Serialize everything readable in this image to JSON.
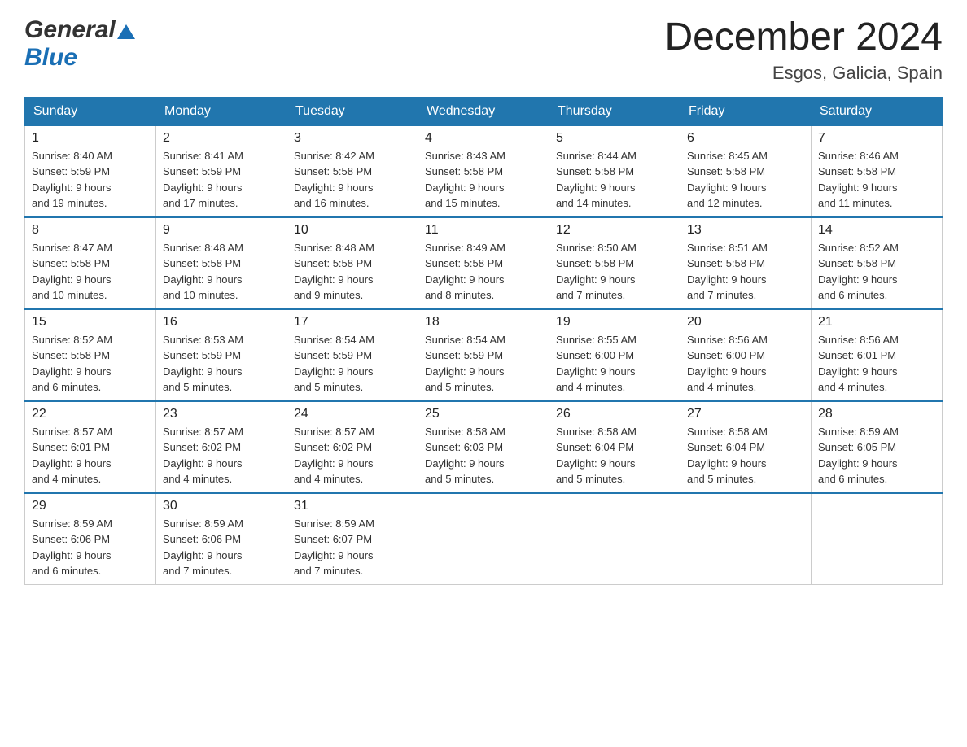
{
  "header": {
    "logo_general": "General",
    "logo_blue": "Blue",
    "month_title": "December 2024",
    "location": "Esgos, Galicia, Spain"
  },
  "weekdays": [
    "Sunday",
    "Monday",
    "Tuesday",
    "Wednesday",
    "Thursday",
    "Friday",
    "Saturday"
  ],
  "weeks": [
    [
      {
        "day": "1",
        "sunrise": "8:40 AM",
        "sunset": "5:59 PM",
        "daylight": "9 hours and 19 minutes."
      },
      {
        "day": "2",
        "sunrise": "8:41 AM",
        "sunset": "5:59 PM",
        "daylight": "9 hours and 17 minutes."
      },
      {
        "day": "3",
        "sunrise": "8:42 AM",
        "sunset": "5:58 PM",
        "daylight": "9 hours and 16 minutes."
      },
      {
        "day": "4",
        "sunrise": "8:43 AM",
        "sunset": "5:58 PM",
        "daylight": "9 hours and 15 minutes."
      },
      {
        "day": "5",
        "sunrise": "8:44 AM",
        "sunset": "5:58 PM",
        "daylight": "9 hours and 14 minutes."
      },
      {
        "day": "6",
        "sunrise": "8:45 AM",
        "sunset": "5:58 PM",
        "daylight": "9 hours and 12 minutes."
      },
      {
        "day": "7",
        "sunrise": "8:46 AM",
        "sunset": "5:58 PM",
        "daylight": "9 hours and 11 minutes."
      }
    ],
    [
      {
        "day": "8",
        "sunrise": "8:47 AM",
        "sunset": "5:58 PM",
        "daylight": "9 hours and 10 minutes."
      },
      {
        "day": "9",
        "sunrise": "8:48 AM",
        "sunset": "5:58 PM",
        "daylight": "9 hours and 10 minutes."
      },
      {
        "day": "10",
        "sunrise": "8:48 AM",
        "sunset": "5:58 PM",
        "daylight": "9 hours and 9 minutes."
      },
      {
        "day": "11",
        "sunrise": "8:49 AM",
        "sunset": "5:58 PM",
        "daylight": "9 hours and 8 minutes."
      },
      {
        "day": "12",
        "sunrise": "8:50 AM",
        "sunset": "5:58 PM",
        "daylight": "9 hours and 7 minutes."
      },
      {
        "day": "13",
        "sunrise": "8:51 AM",
        "sunset": "5:58 PM",
        "daylight": "9 hours and 7 minutes."
      },
      {
        "day": "14",
        "sunrise": "8:52 AM",
        "sunset": "5:58 PM",
        "daylight": "9 hours and 6 minutes."
      }
    ],
    [
      {
        "day": "15",
        "sunrise": "8:52 AM",
        "sunset": "5:58 PM",
        "daylight": "9 hours and 6 minutes."
      },
      {
        "day": "16",
        "sunrise": "8:53 AM",
        "sunset": "5:59 PM",
        "daylight": "9 hours and 5 minutes."
      },
      {
        "day": "17",
        "sunrise": "8:54 AM",
        "sunset": "5:59 PM",
        "daylight": "9 hours and 5 minutes."
      },
      {
        "day": "18",
        "sunrise": "8:54 AM",
        "sunset": "5:59 PM",
        "daylight": "9 hours and 5 minutes."
      },
      {
        "day": "19",
        "sunrise": "8:55 AM",
        "sunset": "6:00 PM",
        "daylight": "9 hours and 4 minutes."
      },
      {
        "day": "20",
        "sunrise": "8:56 AM",
        "sunset": "6:00 PM",
        "daylight": "9 hours and 4 minutes."
      },
      {
        "day": "21",
        "sunrise": "8:56 AM",
        "sunset": "6:01 PM",
        "daylight": "9 hours and 4 minutes."
      }
    ],
    [
      {
        "day": "22",
        "sunrise": "8:57 AM",
        "sunset": "6:01 PM",
        "daylight": "9 hours and 4 minutes."
      },
      {
        "day": "23",
        "sunrise": "8:57 AM",
        "sunset": "6:02 PM",
        "daylight": "9 hours and 4 minutes."
      },
      {
        "day": "24",
        "sunrise": "8:57 AM",
        "sunset": "6:02 PM",
        "daylight": "9 hours and 4 minutes."
      },
      {
        "day": "25",
        "sunrise": "8:58 AM",
        "sunset": "6:03 PM",
        "daylight": "9 hours and 5 minutes."
      },
      {
        "day": "26",
        "sunrise": "8:58 AM",
        "sunset": "6:04 PM",
        "daylight": "9 hours and 5 minutes."
      },
      {
        "day": "27",
        "sunrise": "8:58 AM",
        "sunset": "6:04 PM",
        "daylight": "9 hours and 5 minutes."
      },
      {
        "day": "28",
        "sunrise": "8:59 AM",
        "sunset": "6:05 PM",
        "daylight": "9 hours and 6 minutes."
      }
    ],
    [
      {
        "day": "29",
        "sunrise": "8:59 AM",
        "sunset": "6:06 PM",
        "daylight": "9 hours and 6 minutes."
      },
      {
        "day": "30",
        "sunrise": "8:59 AM",
        "sunset": "6:06 PM",
        "daylight": "9 hours and 7 minutes."
      },
      {
        "day": "31",
        "sunrise": "8:59 AM",
        "sunset": "6:07 PM",
        "daylight": "9 hours and 7 minutes."
      },
      null,
      null,
      null,
      null
    ]
  ],
  "labels": {
    "sunrise": "Sunrise:",
    "sunset": "Sunset:",
    "daylight": "Daylight:"
  }
}
